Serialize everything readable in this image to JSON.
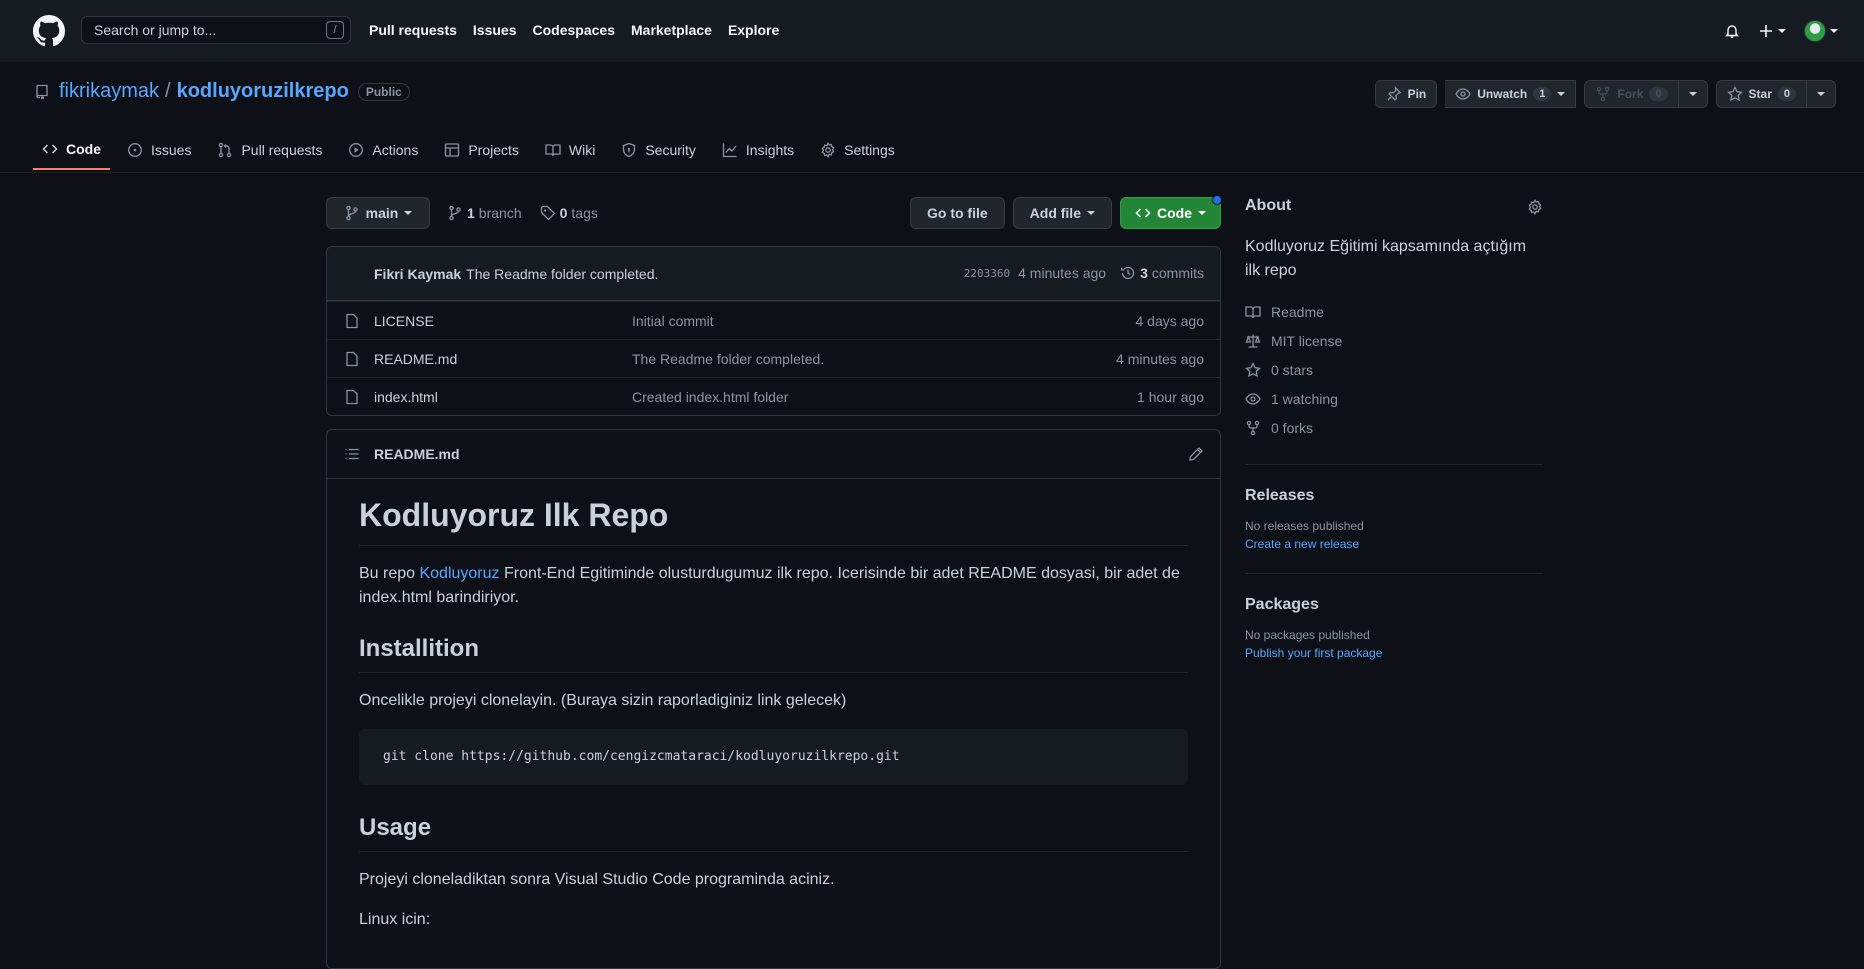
{
  "header": {
    "search_placeholder": "Search or jump to...",
    "search_key": "/",
    "nav": [
      "Pull requests",
      "Issues",
      "Codespaces",
      "Marketplace",
      "Explore"
    ]
  },
  "repo": {
    "owner": "fikrikaymak",
    "separator": "/",
    "name": "kodluyoruzilkrepo",
    "visibility": "Public",
    "pin_label": "Pin",
    "unwatch_label": "Unwatch",
    "watch_count": "1",
    "fork_label": "Fork",
    "fork_count": "0",
    "star_label": "Star",
    "star_count": "0"
  },
  "tabs": [
    "Code",
    "Issues",
    "Pull requests",
    "Actions",
    "Projects",
    "Wiki",
    "Security",
    "Insights",
    "Settings"
  ],
  "branch_bar": {
    "branch": "main",
    "branch_count": "1",
    "branch_word": "branch",
    "tag_count": "0",
    "tag_word": "tags",
    "goto_file": "Go to file",
    "add_file": "Add file",
    "code": "Code"
  },
  "commit": {
    "author": "Fikri Kaymak",
    "message": "The Readme folder completed.",
    "sha": "2203360",
    "time": "4 minutes ago",
    "commit_count": "3",
    "commit_word": "commits"
  },
  "files": [
    {
      "name": "LICENSE",
      "message": "Initial commit",
      "date": "4 days ago"
    },
    {
      "name": "README.md",
      "message": "The Readme folder completed.",
      "date": "4 minutes ago"
    },
    {
      "name": "index.html",
      "message": "Created index.html folder",
      "date": "1 hour ago"
    }
  ],
  "readme": {
    "file_title": "README.md",
    "h1": "Kodluyoruz Ilk Repo",
    "p1_before": "Bu repo ",
    "p1_link": "Kodluyoruz",
    "p1_after": " Front-End Egitiminde olusturdugumuz ilk repo. Icerisinde bir adet README dosyasi, bir adet de index.html barindiriyor.",
    "h2_install": "Installition",
    "p_install": "Oncelikle projeyi clonelayin. (Buraya sizin raporladiginiz link gelecek)",
    "code": "git clone https://github.com/cengizcmataraci/kodluyoruzilkrepo.git",
    "h2_usage": "Usage",
    "p_usage": "Projeyi cloneladiktan sonra Visual Studio Code programinda aciniz.",
    "p_linux": "Linux icin:"
  },
  "about": {
    "title": "About",
    "description": "Kodluyoruz Eğitimi kapsamında açtığım ilk repo",
    "items": [
      "Readme",
      "MIT license",
      "0 stars",
      "1 watching",
      "0 forks"
    ]
  },
  "releases": {
    "title": "Releases",
    "none": "No releases published",
    "link": "Create a new release"
  },
  "packages": {
    "title": "Packages",
    "none": "No packages published",
    "link": "Publish your first package"
  }
}
